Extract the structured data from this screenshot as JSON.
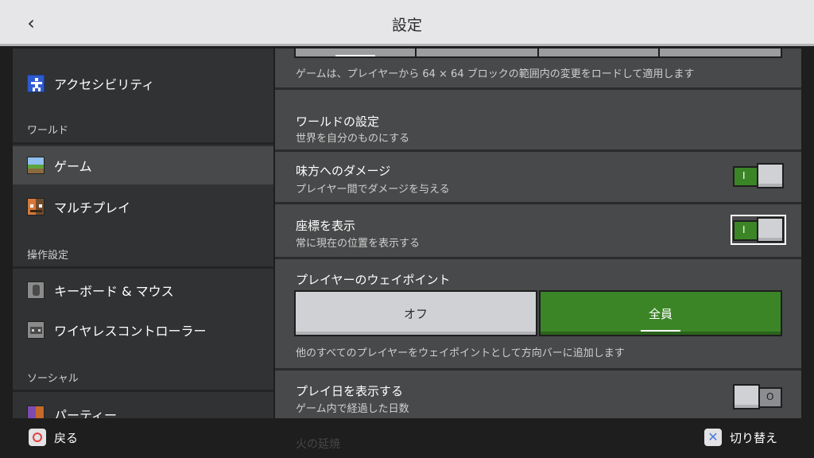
{
  "header": {
    "title": "設定"
  },
  "sidebar": {
    "items": [
      {
        "label": "アクセシビリティ"
      },
      {
        "label": "ゲーム"
      },
      {
        "label": "マルチプレイ"
      },
      {
        "label": "キーボード & マウス"
      },
      {
        "label": "ワイヤレスコントローラー"
      },
      {
        "label": "パーティー"
      }
    ],
    "sections": [
      {
        "label": "ワールド"
      },
      {
        "label": "操作設定"
      },
      {
        "label": "ソーシャル"
      }
    ]
  },
  "content": {
    "chunk_description": "ゲームは、プレイヤーから 64 × 64 ブロックの範囲内の変更をロードして適用します",
    "world_settings": {
      "title": "ワールドの設定",
      "subtitle": "世界を自分のものにする"
    },
    "friendly_fire": {
      "title": "味方へのダメージ",
      "subtitle": "プレイヤー間でダメージを与える",
      "on": true
    },
    "show_coordinates": {
      "title": "座標を表示",
      "subtitle": "常に現在の位置を表示する",
      "on": true
    },
    "waypoints": {
      "title": "プレイヤーのウェイポイント",
      "options": [
        {
          "label": "オフ"
        },
        {
          "label": "全員"
        }
      ],
      "selected": "全員",
      "description": "他のすべてのプレイヤーをウェイポイントとして方向バーに追加します"
    },
    "show_days_played": {
      "title": "プレイ日を表示する",
      "subtitle": "ゲーム内で経過した日数",
      "on": false
    },
    "fire_spread": {
      "title": "火の延焼"
    }
  },
  "toggle_marks": {
    "on": "I",
    "off": "O"
  },
  "footer": {
    "back_label": "戻る",
    "toggle_label": "切り替え"
  },
  "colors": {
    "accent_green": "#3c8527",
    "panel": "#48494a",
    "background": "#313233"
  }
}
